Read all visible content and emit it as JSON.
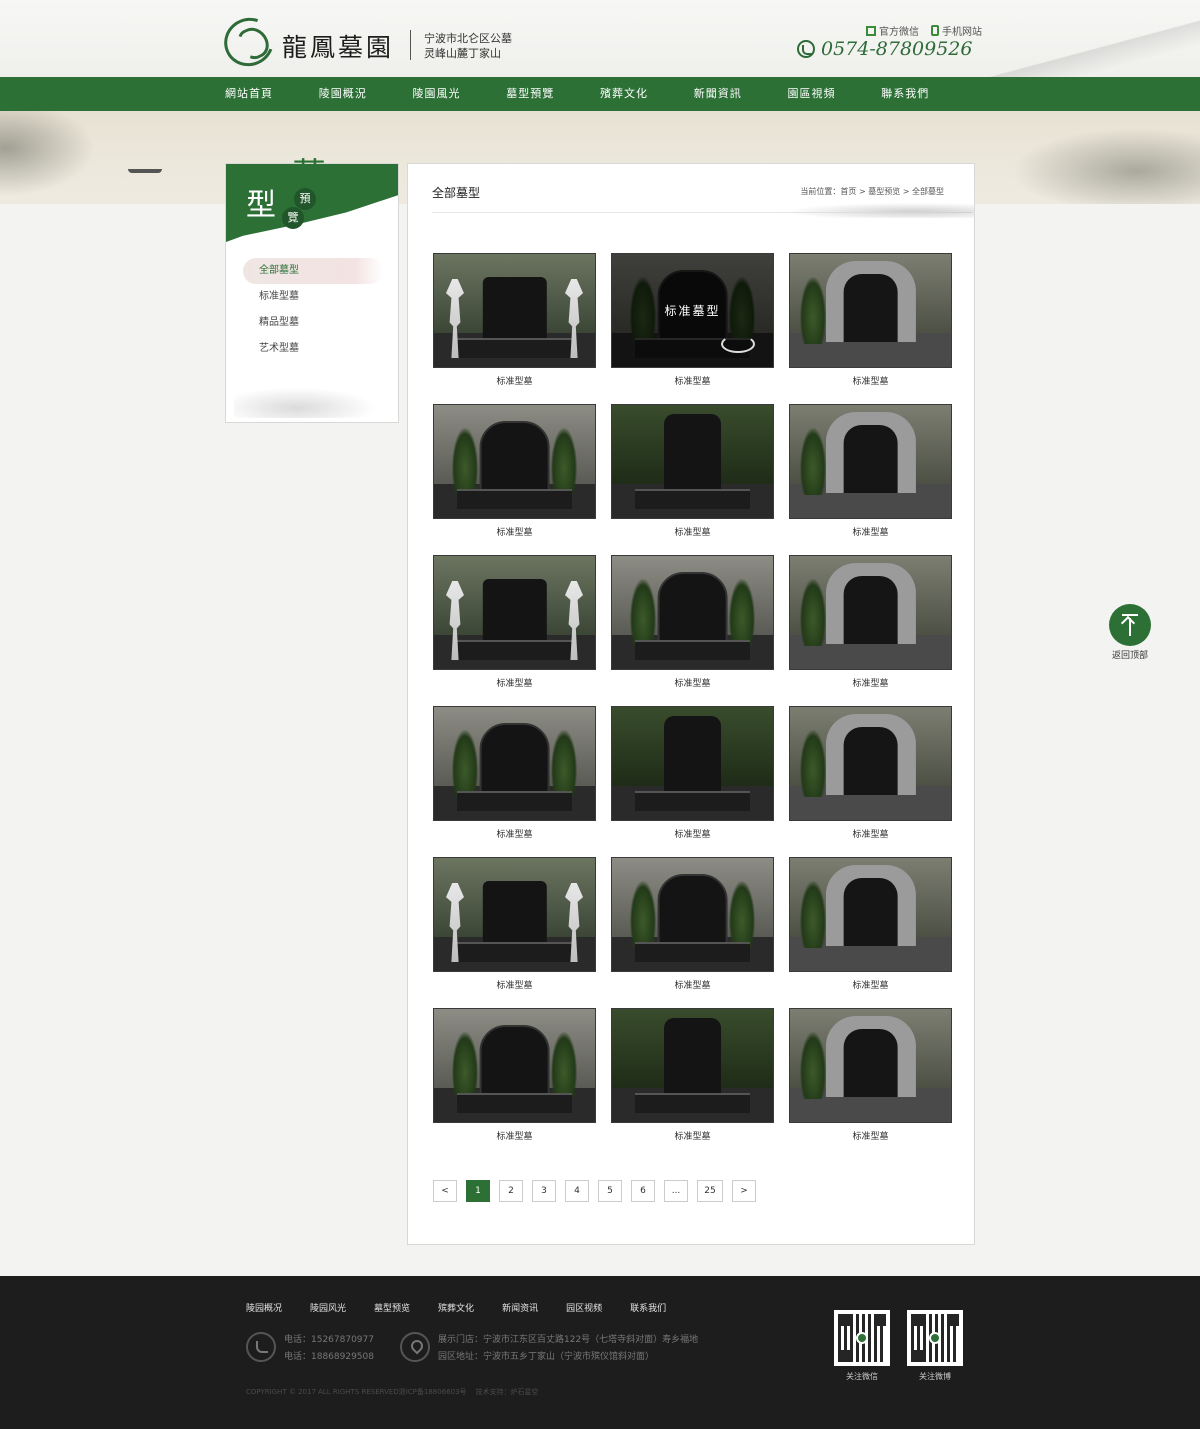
{
  "header": {
    "logo_text": "龍鳳墓園",
    "slogan_line1": "宁波市北仑区公墓",
    "slogan_line2": "灵峰山麓丁家山",
    "wechat_link": "官方微信",
    "mobile_link": "手机网站",
    "hotline": "0574-87809526"
  },
  "nav": {
    "items": [
      "網站首頁",
      "陵園概況",
      "陵園風光",
      "墓型預覽",
      "殯葬文化",
      "新聞資訊",
      "園區視頻",
      "聯系我們"
    ]
  },
  "sidebar": {
    "title_big": "墓",
    "title_main": "型",
    "title_c1": "預",
    "title_c2": "覽",
    "menu": [
      "全部墓型",
      "标准型墓",
      "精品型墓",
      "艺术型墓"
    ],
    "active_index": 0
  },
  "main": {
    "title": "全部墓型",
    "breadcrumb": "当前位置：首页 > 墓型预览 > 全部墓型",
    "overlay_text": "标准墓型",
    "items": [
      "标准型墓",
      "标准型墓",
      "标准型墓",
      "标准型墓",
      "标准型墓",
      "标准型墓",
      "标准型墓",
      "标准型墓",
      "标准型墓",
      "标准型墓",
      "标准型墓",
      "标准型墓",
      "标准型墓",
      "标准型墓",
      "标准型墓",
      "标准型墓",
      "标准型墓",
      "标准型墓"
    ]
  },
  "pagination": {
    "prev": "<",
    "next": ">",
    "pages": [
      "1",
      "2",
      "3",
      "4",
      "5",
      "6",
      "...",
      "25"
    ],
    "current": "1"
  },
  "back_top": {
    "label": "返回顶部"
  },
  "footer": {
    "nav": [
      "陵园概况",
      "陵园风光",
      "墓型预览",
      "殡葬文化",
      "新闻资讯",
      "园区视频",
      "联系我们"
    ],
    "phone1": "电话：15267870977",
    "phone2": "电话：18868929508",
    "address1": "展示门店：宁波市江东区百丈路122号（七塔寺斜对面）寿乡福地",
    "address2": "园区地址：宁波市五乡丁家山（宁波市殡仪馆斜对面）",
    "copyright": "COPYRIGHT © 2017 ALL RIGHTS RESERVED浙ICP备18806603号",
    "tech_support": "技术支持：炉石星空",
    "qr_wechat": "关注微信",
    "qr_weibo": "关注微博"
  },
  "colors": {
    "brand_green": "#2c7036",
    "footer_bg": "#1d1d1d"
  }
}
